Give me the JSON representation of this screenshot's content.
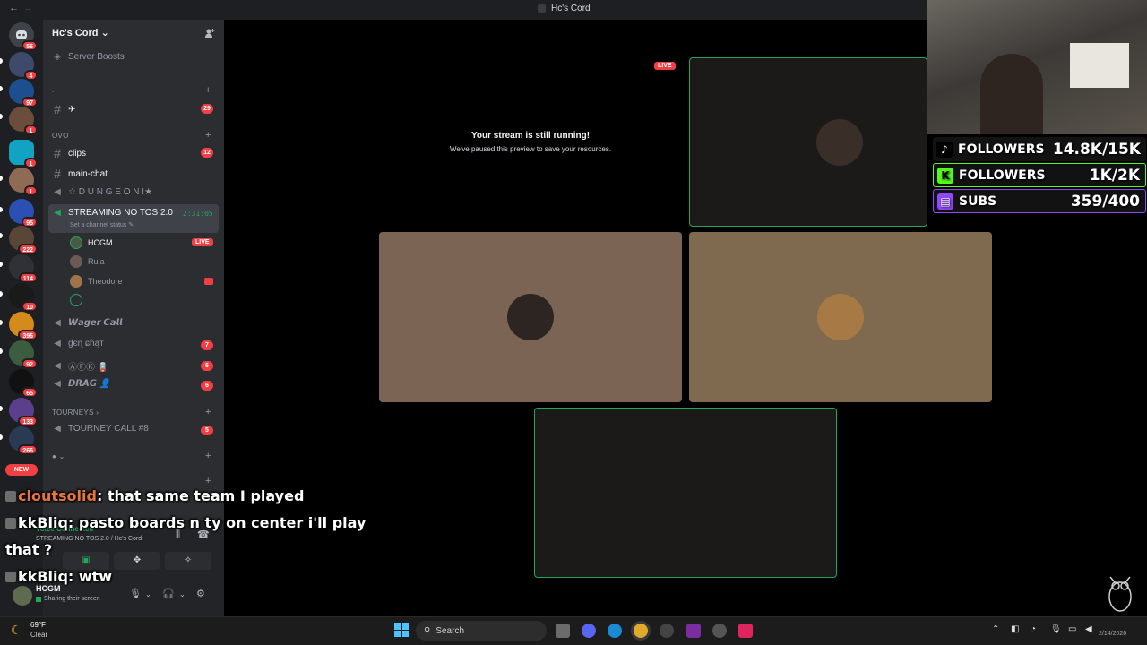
{
  "window": {
    "title": "Hc's Cord",
    "back_glyph": "←",
    "forward_glyph": "→"
  },
  "server_rail": {
    "badges": [
      "56",
      "4",
      "97",
      "1",
      "1",
      "1",
      "95",
      "222",
      "114",
      "10",
      "396",
      "92",
      "65",
      "133",
      "266"
    ],
    "new_label": "NEW"
  },
  "sidebar": {
    "guild_name": "Hc's Cord",
    "guild_chevron": "⌄",
    "server_boosts": "Server Boosts",
    "category_dot": ".",
    "channel_plane": "✈",
    "channel_plane_badge": "29",
    "category_ovo": "OVO",
    "channels": [
      {
        "name": "clips",
        "badge": "12"
      },
      {
        "name": "main-chat",
        "badge": ""
      }
    ],
    "dungeon": "☆ D U N G E O N !★",
    "active_voice": {
      "name": "STREAMING NO TOS 2.0",
      "timer": "2:31:05",
      "status": "Set a channel status"
    },
    "voice_users": [
      {
        "name": "HCGM",
        "live": "LIVE"
      },
      {
        "name": "Rula",
        "live": ""
      },
      {
        "name": "Theodore",
        "live": ""
      }
    ],
    "voice_channels": [
      {
        "name": "𝙒𝙖𝙜𝙚𝙧 𝘾𝙖𝙡𝙡",
        "badge": ""
      },
      {
        "name": "ɠєɳ ɕɦąт",
        "badge": "7"
      },
      {
        "name": "ⒶⒻⓀ 🪫",
        "badge": "6"
      },
      {
        "name": "𝘿𝙍𝘼𝙂 👤",
        "badge": "6"
      }
    ],
    "category_tourneys": "TOURNEYS",
    "tourney_channel": {
      "name": "TOURNEY CALL #8",
      "badge": "5"
    }
  },
  "voice_panel": {
    "connection": "Voice Connected",
    "channel_path": "STREAMING NO TOS 2.0 / Hc's Cord",
    "username": "HCGM",
    "user_status": "Sharing their screen"
  },
  "stage": {
    "live_label": "LIVE",
    "paused_title": "Your stream is still running!",
    "paused_sub": "We've paused this preview to save your resources.",
    "colors": {
      "tile_brown": "#7b6453",
      "tile_tan": "#7f6a50",
      "tile_dark": "#1b1a18",
      "speaking_border": "#23a55a"
    }
  },
  "chat_overlay": [
    {
      "user": "cloutsolid",
      "message": "that same team I played"
    },
    {
      "user": "kkBliq",
      "message": "pasto boards n ty on center i'll play"
    },
    {
      "user": "",
      "message": "that ?"
    },
    {
      "user": "kkBliq",
      "message": "wtw"
    }
  ],
  "goals": [
    {
      "platform": "tiktok-icon",
      "label": "FOLLOWERS",
      "value": "14.8K/15K",
      "color": "#000000"
    },
    {
      "platform": "kick-icon",
      "label": "FOLLOWERS",
      "value": "1K/2K",
      "color": "#53fc18"
    },
    {
      "platform": "twitch-icon",
      "label": "SUBS",
      "value": "359/400",
      "color": "#9146ff"
    }
  ],
  "taskbar": {
    "weather_temp": "69°F",
    "weather_desc": "Clear",
    "search_placeholder": "Search",
    "clock": "2/14/2026"
  }
}
